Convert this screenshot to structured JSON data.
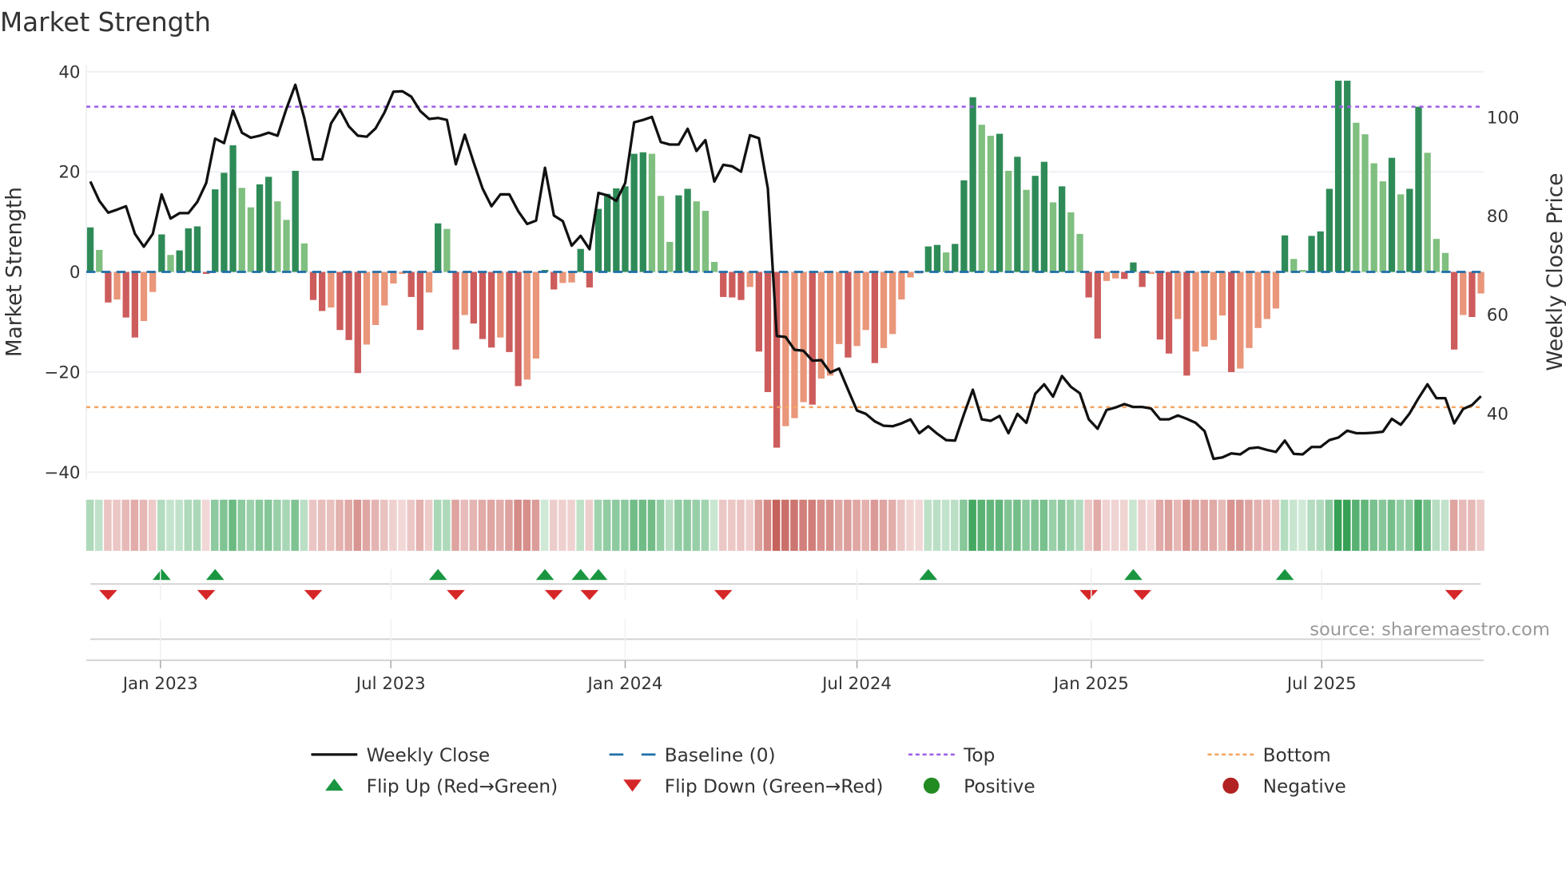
{
  "title": "Market Strength",
  "source": "source: sharemaestro.com",
  "chart_data": {
    "type": "bar+line",
    "title": "Market Strength",
    "start_date": "2022-11-07",
    "frequency": "weekly",
    "strength": [
      8.9,
      4.4,
      -6.1,
      -5.5,
      -9.1,
      -13.1,
      -9.8,
      -4.0,
      7.5,
      3.4,
      4.3,
      8.7,
      9.1,
      -0.4,
      16.5,
      19.8,
      25.3,
      16.8,
      12.9,
      17.5,
      19.0,
      14.1,
      10.4,
      20.2,
      5.7,
      -5.6,
      -7.8,
      -7.1,
      -11.6,
      -13.6,
      -20.2,
      -14.5,
      -10.6,
      -6.7,
      -2.3,
      -0.4,
      -5.0,
      -11.6,
      -4.1,
      9.7,
      8.6,
      -15.5,
      -8.6,
      -10.3,
      -13.4,
      -15.1,
      -13.1,
      -16.0,
      -22.8,
      -21.5,
      -17.3,
      0.4,
      -3.5,
      -2.2,
      -2.1,
      4.6,
      -3.1,
      12.6,
      15.6,
      16.7,
      17.1,
      23.6,
      23.9,
      23.6,
      15.2,
      6.0,
      15.3,
      16.6,
      14.1,
      12.2,
      2.0,
      -5.0,
      -5.1,
      -5.6,
      -3.0,
      -15.9,
      -24.0,
      -35.1,
      -30.8,
      -29.2,
      -26.0,
      -26.5,
      -21.3,
      -20.7,
      -14.4,
      -17.1,
      -14.8,
      -11.6,
      -18.2,
      -15.2,
      -12.4,
      -5.5,
      -1.1,
      -0.3,
      5.1,
      5.4,
      3.9,
      5.6,
      18.3,
      34.9,
      29.4,
      27.2,
      27.6,
      20.2,
      23.0,
      16.4,
      19.2,
      22.0,
      13.9,
      17.1,
      11.9,
      7.6,
      -5.1,
      -13.3,
      -1.8,
      -1.3,
      -1.4,
      1.9,
      -3.0,
      -0.4,
      -13.5,
      -16.3,
      -9.4,
      -20.7,
      -15.9,
      -14.9,
      -13.6,
      -8.7,
      -20.0,
      -19.3,
      -15.2,
      -11.2,
      -9.4,
      -7.3,
      7.3,
      2.6,
      0.4,
      7.2,
      8.1,
      16.6,
      38.2,
      38.2,
      29.8,
      27.5,
      21.7,
      18.1,
      22.8,
      15.5,
      16.6,
      33.0,
      23.8,
      6.6,
      3.8,
      -15.5,
      -8.6,
      -9.0,
      -4.3
    ],
    "close": [
      87.0,
      83.1,
      80.7,
      81.3,
      82.0,
      76.4,
      73.8,
      76.4,
      84.4,
      79.5,
      80.6,
      80.6,
      82.9,
      86.7,
      95.7,
      94.8,
      101.4,
      96.9,
      95.9,
      96.3,
      96.9,
      96.3,
      101.8,
      106.6,
      99.9,
      91.5,
      91.5,
      98.8,
      101.6,
      98.2,
      96.3,
      96.1,
      97.8,
      101.0,
      105.2,
      105.3,
      104.2,
      101.3,
      99.7,
      99.9,
      99.5,
      90.5,
      96.5,
      90.9,
      85.6,
      82.0,
      84.4,
      84.4,
      81.0,
      78.4,
      79.1,
      89.8,
      80.1,
      79.0,
      74.0,
      76.0,
      73.3,
      84.7,
      84.2,
      83.1,
      86.7,
      99.0,
      99.5,
      100.1,
      95.0,
      94.5,
      94.5,
      97.7,
      93.2,
      95.4,
      87.0,
      90.4,
      90.1,
      89.0,
      96.4,
      95.8,
      85.6,
      55.7,
      55.5,
      52.9,
      52.7,
      50.7,
      50.8,
      48.3,
      49.1,
      44.8,
      40.6,
      39.9,
      38.4,
      37.5,
      37.4,
      38.0,
      38.8,
      36.0,
      37.4,
      35.9,
      34.6,
      34.5,
      39.8,
      44.8,
      38.8,
      38.5,
      39.5,
      36.0,
      39.9,
      38.1,
      44.0,
      45.9,
      43.4,
      47.6,
      45.4,
      44.1,
      38.8,
      36.9,
      40.7,
      41.2,
      41.9,
      41.3,
      41.3,
      41.0,
      38.8,
      38.8,
      39.6,
      38.9,
      38.1,
      36.4,
      30.8,
      31.1,
      31.9,
      31.7,
      32.9,
      33.1,
      32.6,
      32.2,
      34.5,
      31.8,
      31.7,
      33.2,
      33.2,
      34.6,
      35.1,
      36.5,
      36.0,
      36.0,
      36.1,
      36.3,
      38.9,
      37.7,
      40.0,
      43.1,
      45.9,
      43.1,
      43.1,
      38.0,
      40.9,
      41.7,
      43.5
    ],
    "top": 33,
    "bottom": -27,
    "baseline": 0,
    "left_axis": {
      "label": "Market Strength",
      "ticks": [
        40,
        20,
        0,
        -20,
        -40
      ],
      "tick_labels": [
        "40",
        "20",
        "0",
        "−20",
        "−40"
      ],
      "ylim": [
        -41.5,
        41.5
      ]
    },
    "right_axis": {
      "label": "Weekly Close Price",
      "ticks": [
        100,
        80,
        60,
        40
      ],
      "tick_labels": [
        "100",
        "80",
        "60",
        "40"
      ],
      "ylim": [
        26.6,
        110.6
      ]
    },
    "x_ticks": [
      {
        "date": "2023-01-01",
        "label": "Jan 2023"
      },
      {
        "date": "2023-07-01",
        "label": "Jul 2023"
      },
      {
        "date": "2024-01-01",
        "label": "Jan 2024"
      },
      {
        "date": "2024-07-01",
        "label": "Jul 2024"
      },
      {
        "date": "2025-01-01",
        "label": "Jan 2025"
      },
      {
        "date": "2025-07-01",
        "label": "Jul 2025"
      }
    ],
    "grid": true,
    "legend_position": "bottom",
    "legend": [
      {
        "key": "close",
        "label": "Weekly Close"
      },
      {
        "key": "baseline",
        "label": "Baseline (0)"
      },
      {
        "key": "top",
        "label": "Top"
      },
      {
        "key": "bottom",
        "label": "Bottom"
      },
      {
        "key": "flip_up",
        "label": "Flip Up (Red→Green)"
      },
      {
        "key": "flip_down",
        "label": "Flip Down (Green→Red)"
      },
      {
        "key": "positive",
        "label": "Positive"
      },
      {
        "key": "negative",
        "label": "Negative"
      }
    ]
  },
  "colors": {
    "pos_strong": "#2e8b57",
    "pos_weak": "#7fbf7f",
    "neg_strong": "#cd5c5c",
    "neg_weak": "#e9967a",
    "line": "#111111",
    "baseline": "#1f6fa8",
    "top": "#9b5de5",
    "bottom": "#f4a460",
    "flip_up": "#1a9641",
    "flip_down": "#d62728",
    "positive": "#228b22",
    "negative": "#b22222"
  }
}
